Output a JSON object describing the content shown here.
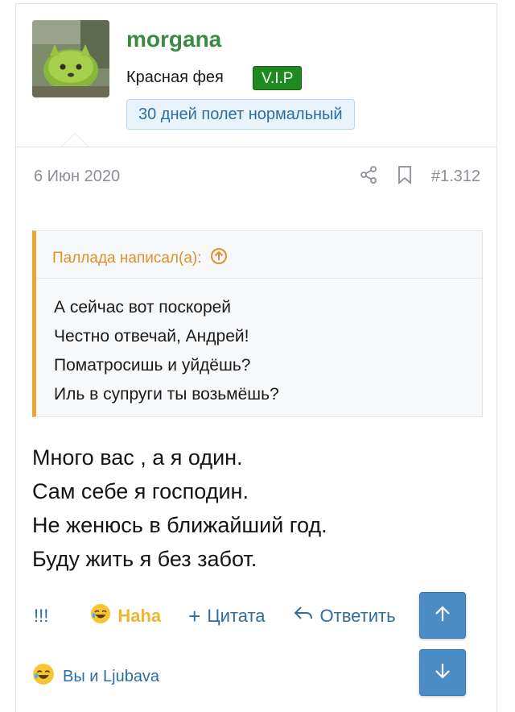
{
  "user": {
    "name": "morgana",
    "title": "Красная фея",
    "badge": "V.I.P",
    "status": "30 дней полет нормальный"
  },
  "meta": {
    "date": "6 Июн 2020",
    "post_number": "#1.312",
    "icons": [
      "share-icon",
      "bookmark-icon"
    ]
  },
  "quote": {
    "header": "Паллада написал(а):",
    "lines": [
      "А сейчас вот поскорей",
      "Честно отвечай, Андрей!",
      "Поматросишь и уйдёшь?",
      "Иль в супруги ты возьмёшь?"
    ]
  },
  "body": {
    "lines": [
      "Много вас , а я один.",
      "Сам себе я господин.",
      "Не женюсь в ближайший год.",
      "Буду жить я без забот."
    ]
  },
  "actions": {
    "report": "!!!",
    "reaction": "Haha",
    "quote": "Цитата",
    "reply": "Ответить"
  },
  "reactions_summary": "Вы и Ljubava",
  "colors": {
    "username": "#3a8a3f",
    "badge_bg": "#1f8a1f",
    "link": "#2b6ea4",
    "quote_accent": "#f1a33a",
    "nav_button": "#4a8cc6"
  }
}
